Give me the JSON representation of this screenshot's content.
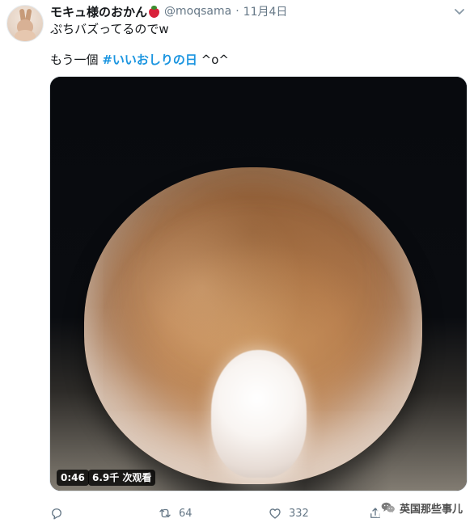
{
  "tweet": {
    "display_name": "モキュ様のおかん",
    "handle": "@moqsama",
    "separator": "·",
    "date": "11月4日",
    "text_line_1": "ぷちバズってるのでw",
    "text_line_2_prefix": "もう一個 ",
    "hashtag": "#いいおしりの日",
    "text_line_2_suffix": " ^o^"
  },
  "media": {
    "duration": "0:46",
    "views": "6.9千 次观看"
  },
  "actions": {
    "reply_count": "",
    "retweet_count": "64",
    "like_count": "332",
    "share_count": ""
  },
  "watermark": {
    "text": "英国那些事儿"
  },
  "icons": {
    "avatar": "rabbit-avatar-icon",
    "name_emoji": "strawberry-icon",
    "menu": "chevron-down-icon",
    "reply": "reply-icon",
    "retweet": "retweet-icon",
    "like": "heart-icon",
    "share": "share-icon",
    "watermark": "wechat-icon"
  },
  "colors": {
    "primary_text": "#14171a",
    "secondary_text": "#657786",
    "hashtag": "#1b95e0",
    "strawberry": "#d9213a"
  }
}
